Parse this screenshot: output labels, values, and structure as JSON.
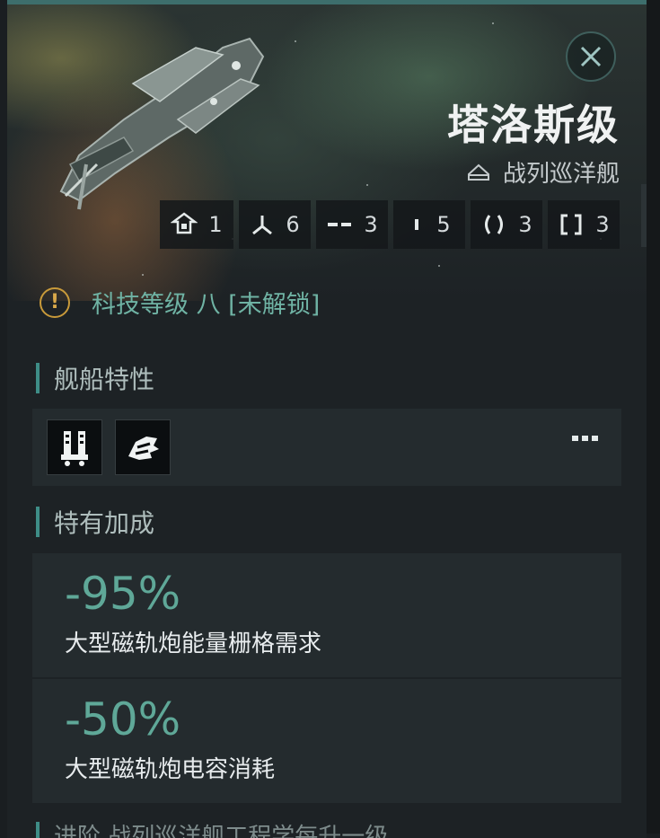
{
  "ship": {
    "name": "塔洛斯级",
    "class_label": "战列巡洋舰"
  },
  "stats": [
    {
      "icon": "hangar-icon",
      "value": "1"
    },
    {
      "icon": "tri-branch-icon",
      "value": "6"
    },
    {
      "icon": "double-dash-icon",
      "value": "3"
    },
    {
      "icon": "single-bar-icon",
      "value": "5"
    },
    {
      "icon": "parentheses-icon",
      "value": "3"
    },
    {
      "icon": "brackets-icon",
      "value": "3"
    }
  ],
  "tech_level": "科技等级 八 [未解锁]",
  "sections": {
    "traits_title": "舰船特性",
    "bonus_title": "特有加成"
  },
  "traits": [
    {
      "icon": "rail-launcher-icon"
    },
    {
      "icon": "armored-fist-icon"
    }
  ],
  "bonuses": [
    {
      "value": "-95%",
      "desc": "大型磁轨炮能量栅格需求"
    },
    {
      "value": "-50%",
      "desc": "大型磁轨炮电容消耗"
    }
  ],
  "next_section_partial": "进阶 战列巡洋舰工程学每升一级",
  "colors": {
    "accent": "#3e8d87",
    "bonus_value": "#5fa898",
    "tech_text": "#6fb3a4",
    "warning": "#c89a3a"
  }
}
